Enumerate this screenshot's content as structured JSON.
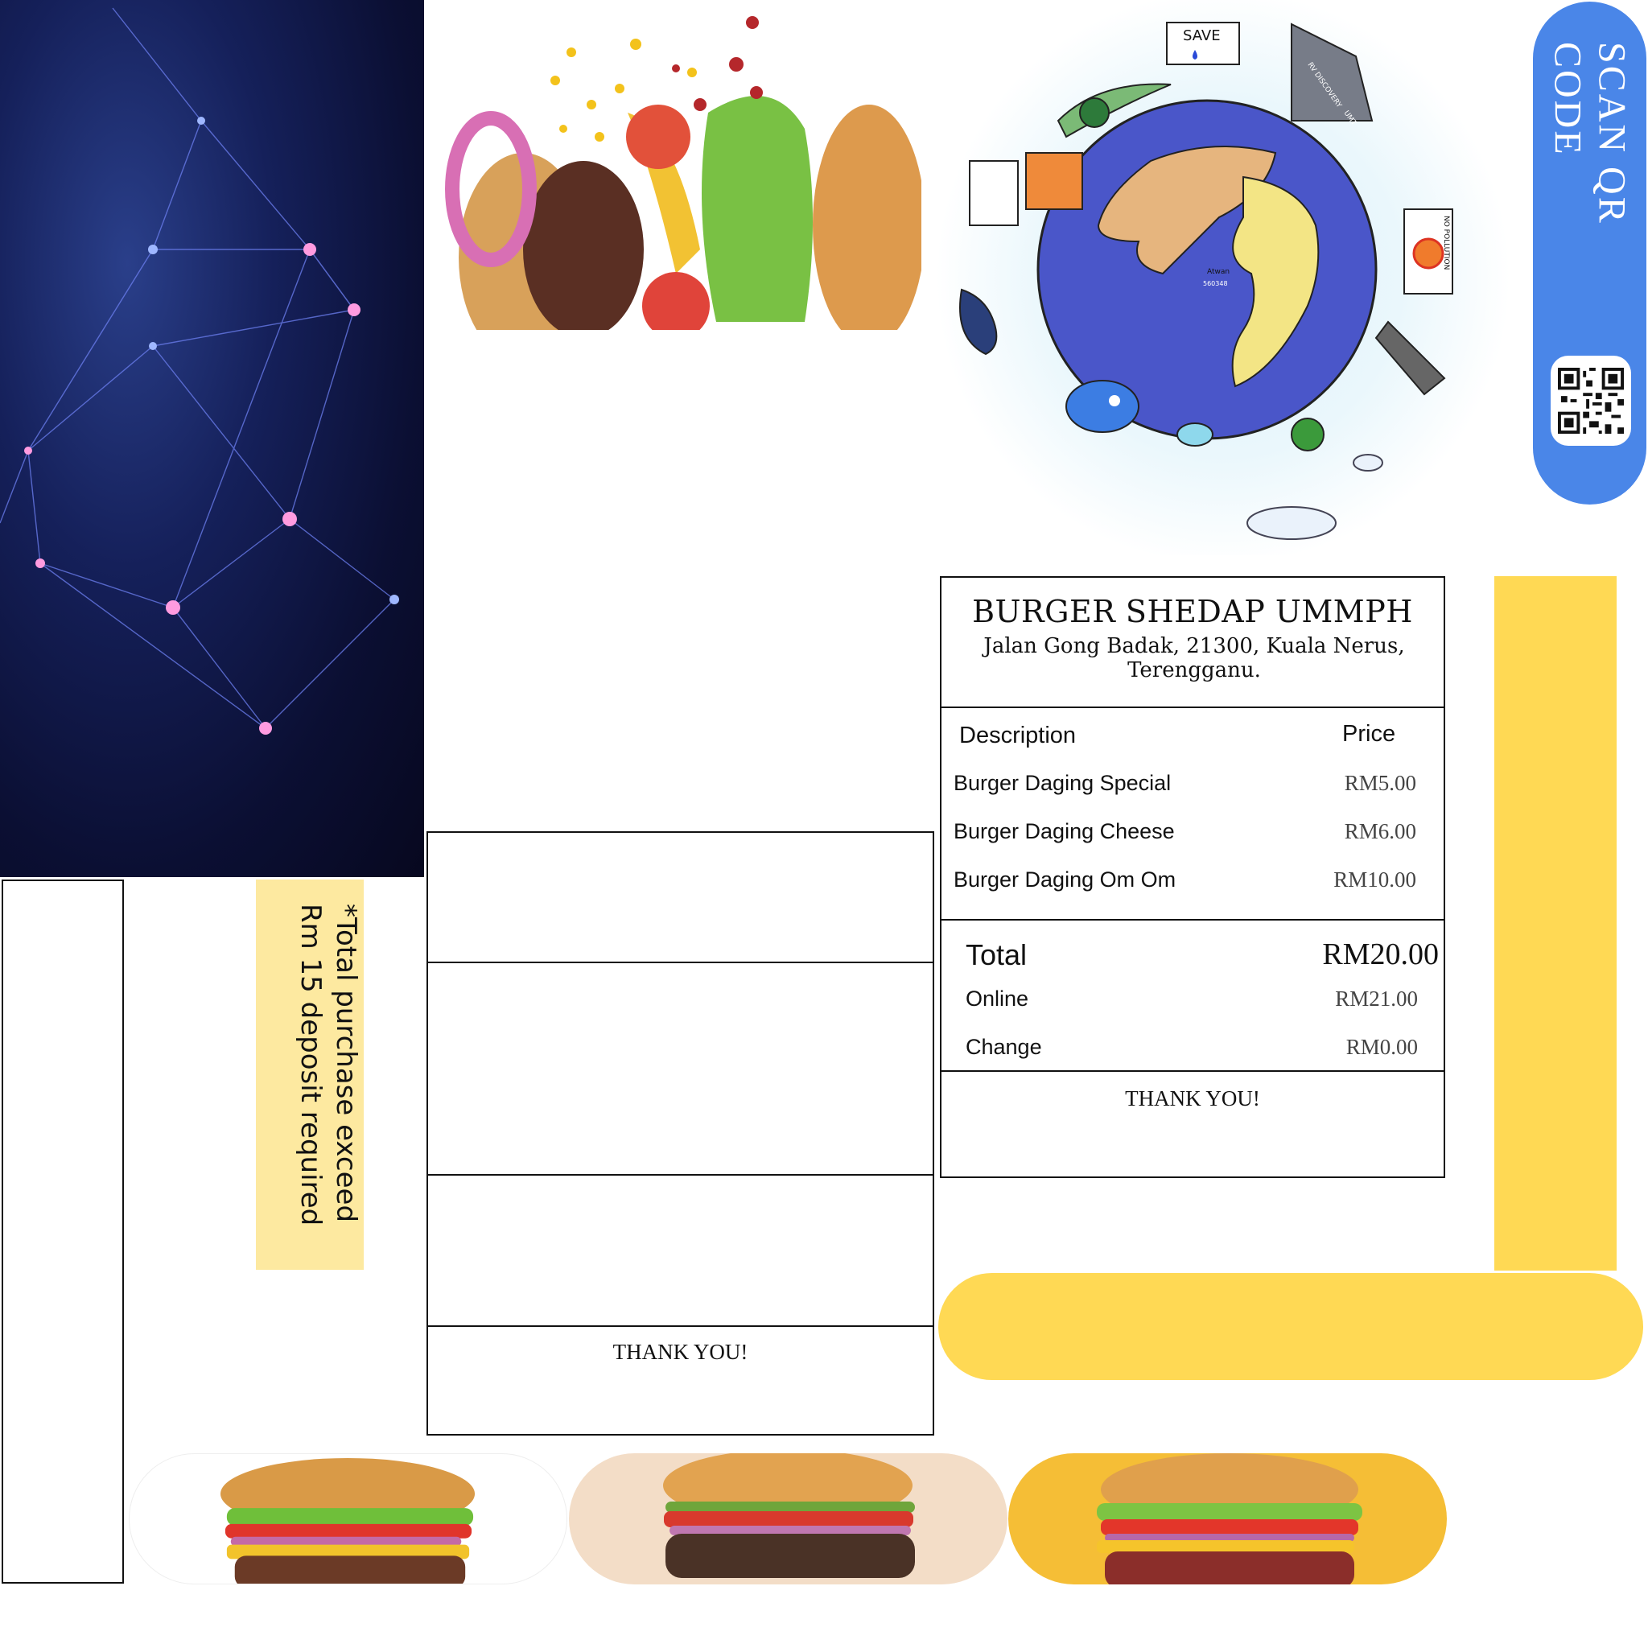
{
  "qr": {
    "label": "SCAN QR CODE"
  },
  "receipt": {
    "shop_name": "BURGER SHEDAP  UMMPH",
    "address": "Jalan Gong Badak, 21300, Kuala Nerus, Terengganu.",
    "columns": {
      "description": "Description",
      "price": "Price"
    },
    "items": [
      {
        "name": "Burger Daging Special",
        "price": "RM5.00"
      },
      {
        "name": "Burger Daging Cheese",
        "price": "RM6.00"
      },
      {
        "name": "Burger Daging Om Om",
        "price": "RM10.00"
      }
    ],
    "total_label": "Total",
    "total_value": "RM20.00",
    "online_label": "Online",
    "online_value": "RM21.00",
    "change_label": "Change",
    "change_value": "RM0.00",
    "thanks": "THANK YOU!"
  },
  "frame2": {
    "thanks": "THANK YOU!"
  },
  "deposit_note": {
    "text": "*Total purchase exceed Rm 15 deposit required"
  },
  "globe_art": {
    "sign_save": "SAVE",
    "sign_no_pollution": "NO POLLUTION",
    "ship_text": "RV DISCOVERY",
    "ship_text_2": "UMT",
    "map_label": "Atwan",
    "map_label_2": "560348"
  },
  "colors": {
    "accent_blue": "#4a86e8",
    "accent_yellow": "#ffd954",
    "note_yellow": "#fde9a0"
  }
}
